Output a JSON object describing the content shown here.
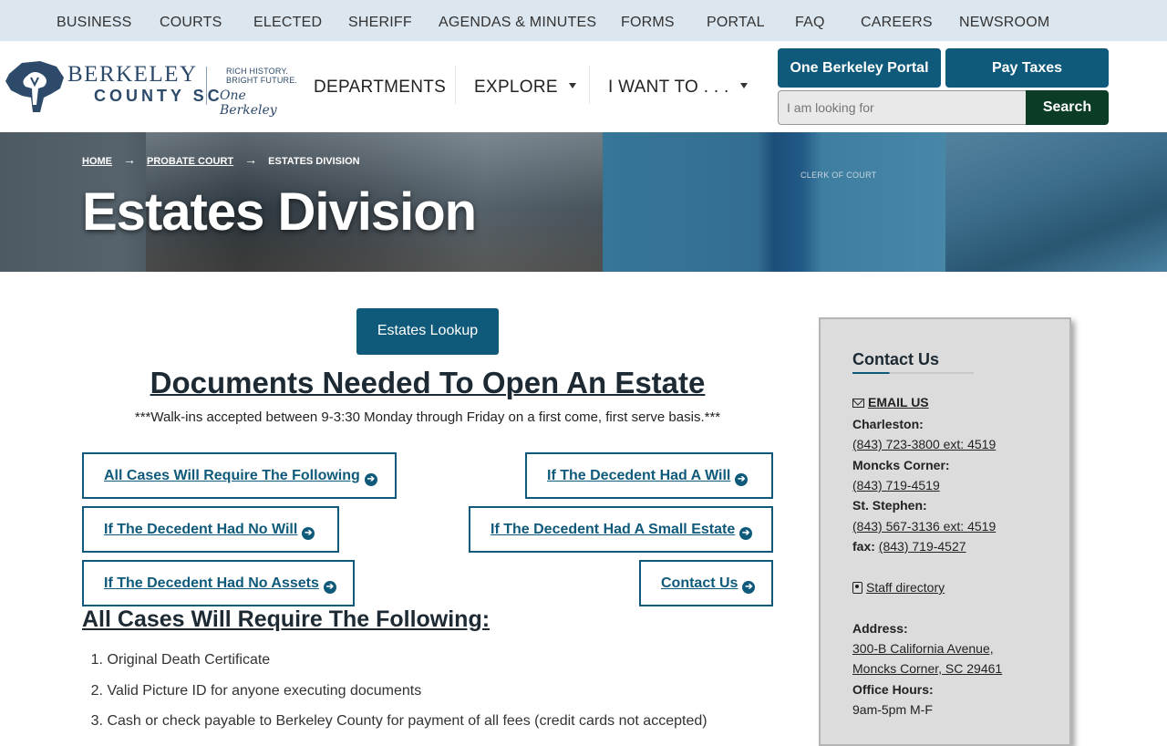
{
  "top_nav": [
    "BUSINESS",
    "COURTS",
    "ELECTED",
    "SHERIFF",
    "AGENDAS & MINUTES",
    "FORMS",
    "PORTAL",
    "FAQ",
    "CAREERS",
    "NEWSROOM"
  ],
  "logo": {
    "name_line1": "BERKELEY",
    "name_line2": "COUNTY SC",
    "tagline1": "RICH HISTORY.",
    "tagline2": "BRIGHT FUTURE.",
    "script": "One Berkeley"
  },
  "main_nav": {
    "departments": "DEPARTMENTS",
    "explore": "EXPLORE",
    "i_want_to": "I WANT TO . . ."
  },
  "header_buttons": {
    "portal": "One Berkeley Portal",
    "pay_taxes": "Pay Taxes"
  },
  "search": {
    "placeholder": "I am looking for",
    "button": "Search"
  },
  "hero": {
    "breadcrumb": [
      "HOME",
      "PROBATE COURT",
      "ESTATES DIVISION"
    ],
    "title": "Estates Division",
    "image_text": "CLERK OF COURT"
  },
  "main": {
    "lookup_button": "Estates Lookup",
    "title": "Documents Needed To Open An Estate",
    "walkin_note": "***Walk-ins accepted between 9-3:30 Monday through Friday on a first come, first serve basis.***",
    "links": [
      "All Cases Will Require The Following",
      "If The Decedent Had A Will",
      "If The Decedent Had No Will",
      "If The Decedent Had A Small Estate",
      "If The Decedent Had No Assets",
      "Contact Us"
    ],
    "section_title": "All Cases Will Require The Following:",
    "requirements": [
      "Original Death Certificate",
      "Valid Picture ID for anyone executing documents",
      "Cash or check payable to Berkeley County for payment of all fees (credit cards not accepted)"
    ]
  },
  "sidebar": {
    "title": "Contact Us",
    "email": "EMAIL US",
    "charleston_label": "Charleston:",
    "charleston_phone": "(843) 723-3800 ext: 4519",
    "moncks_label": "Moncks Corner:",
    "moncks_phone": "(843) 719-4519",
    "stephen_label": "St. Stephen:",
    "stephen_phone": "(843) 567-3136 ext: 4519",
    "fax_label": "fax:",
    "fax_number": "(843) 719-4527",
    "staff_directory": "Staff directory",
    "address_label": "Address:",
    "address_line1": "300-B California Avenue,",
    "address_line2": "Moncks Corner, SC 29461",
    "hours_label": "Office Hours:",
    "hours": "9am-5pm M-F"
  }
}
